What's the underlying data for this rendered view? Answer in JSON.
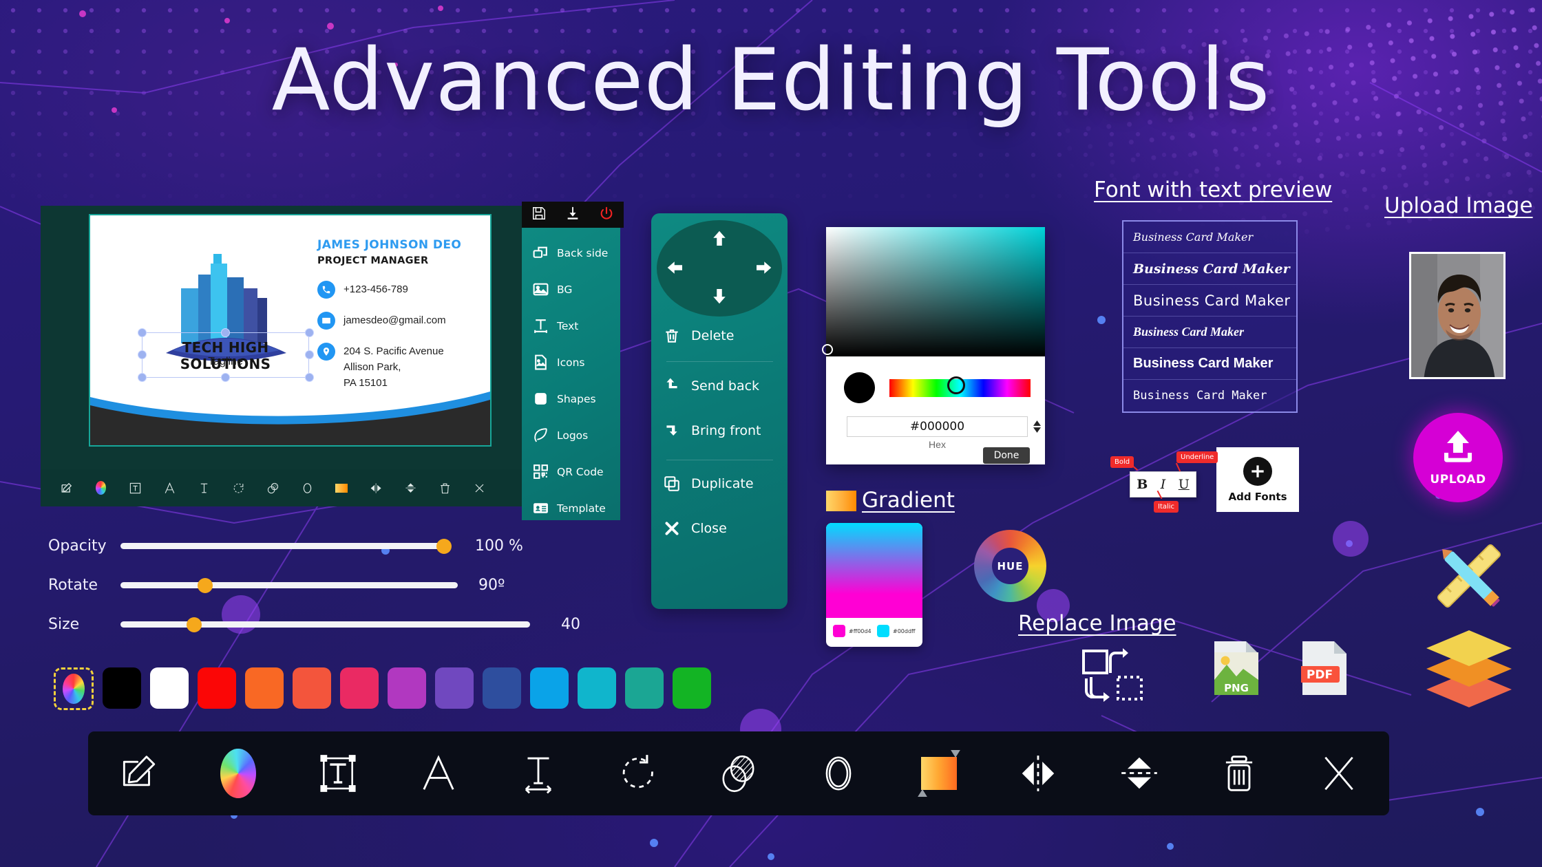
{
  "page": {
    "title": "Advanced Editing Tools"
  },
  "card": {
    "brand_name": "TECH HIGH SOLUTIONS",
    "tagline": "Tagline",
    "person_name": "JAMES JOHNSON DEO",
    "person_role": "PROJECT MANAGER",
    "phone": "+123-456-789",
    "email": "jamesdeo@gmail.com",
    "address_line1": "204 S. Pacific Avenue",
    "address_line2": "Allison Park,",
    "address_line3": "PA 15101"
  },
  "mini_toolbar": {
    "items": [
      {
        "icon": "edit-pencil-icon"
      },
      {
        "icon": "color-wheel-icon"
      },
      {
        "icon": "text-box-icon"
      },
      {
        "icon": "font-a-icon"
      },
      {
        "icon": "text-height-icon"
      },
      {
        "icon": "rotate-icon"
      },
      {
        "icon": "opacity-icon"
      },
      {
        "icon": "shape-circle-icon"
      },
      {
        "icon": "gradient-icon"
      },
      {
        "icon": "flip-horizontal-icon"
      },
      {
        "icon": "flip-vertical-icon"
      },
      {
        "icon": "trash-icon"
      },
      {
        "icon": "close-x-icon"
      }
    ]
  },
  "side_header": {
    "items": [
      {
        "label": "Save",
        "icon": "save-floppy-icon"
      },
      {
        "label": "Download",
        "icon": "download-icon"
      },
      {
        "label": "Power",
        "icon": "power-icon"
      }
    ]
  },
  "side_menu": {
    "items": [
      {
        "label": "Back side",
        "icon": "back-side-icon"
      },
      {
        "label": "BG",
        "icon": "image-bg-icon"
      },
      {
        "label": "Text",
        "icon": "text-tool-icon"
      },
      {
        "label": "Icons",
        "icon": "icons-file-icon"
      },
      {
        "label": "Shapes",
        "icon": "shapes-square-icon"
      },
      {
        "label": "Logos",
        "icon": "leaf-logo-icon"
      },
      {
        "label": "QR Code",
        "icon": "qr-code-icon"
      },
      {
        "label": "Template",
        "icon": "template-card-icon"
      }
    ]
  },
  "transform_panel": {
    "dpad": {
      "up": "move-up-arrow-icon",
      "down": "move-down-arrow-icon",
      "left": "move-left-arrow-icon",
      "right": "move-right-arrow-icon"
    },
    "items": [
      {
        "label": "Delete",
        "icon": "trash-icon"
      },
      {
        "label": "Send back",
        "icon": "send-back-icon"
      },
      {
        "label": "Bring front",
        "icon": "bring-front-icon"
      },
      {
        "label": "Duplicate",
        "icon": "duplicate-icon"
      },
      {
        "label": "Close",
        "icon": "close-x-icon"
      }
    ]
  },
  "color_picker": {
    "hex_value": "#000000",
    "hex_label": "Hex",
    "done_label": "Done",
    "swatch_color": "#000000"
  },
  "labels": {
    "font_preview": "Font with text preview",
    "upload_image": "Upload Image",
    "gradient": "Gradient",
    "replace_image": "Replace Image"
  },
  "gradient": {
    "color_1": "#ff00d4",
    "color_2": "#00ddff",
    "chip_1_label": "#ff00d4",
    "chip_2_label": "#00ddff"
  },
  "hue_wheel": {
    "label": "HUE"
  },
  "font_list": {
    "items": [
      {
        "label": "Business Card Maker"
      },
      {
        "label": "Business Card Maker"
      },
      {
        "label": "Business Card Maker"
      },
      {
        "label": "Business Card Maker"
      },
      {
        "label": "Business Card Maker"
      },
      {
        "label": "Business Card Maker"
      }
    ]
  },
  "text_style": {
    "bold_letter": "B",
    "italic_letter": "I",
    "underline_letter": "U",
    "bold_tag": "Bold",
    "italic_tag": "Italic",
    "underline_tag": "Underline"
  },
  "add_fonts": {
    "label": "Add Fonts",
    "icon": "plus-circle-icon"
  },
  "upload": {
    "label": "UPLOAD",
    "icon": "upload-arrow-icon"
  },
  "file_icons": {
    "png_label": "PNG",
    "pdf_label": "PDF"
  },
  "sliders": [
    {
      "label": "Opacity",
      "value_text": "100 %",
      "percent": 100
    },
    {
      "label": "Rotate",
      "value_text": "90º",
      "percent": 25
    },
    {
      "label": "Size",
      "value_text": "40",
      "percent": 18
    }
  ],
  "swatches": [
    {
      "name": "custom-color-picker",
      "color": "rainbow"
    },
    {
      "name": "black",
      "color": "#000000"
    },
    {
      "name": "white",
      "color": "#ffffff"
    },
    {
      "name": "red",
      "color": "#fb0606"
    },
    {
      "name": "orange",
      "color": "#f96824"
    },
    {
      "name": "tomato",
      "color": "#f3553c"
    },
    {
      "name": "pink",
      "color": "#ea2a63"
    },
    {
      "name": "magenta",
      "color": "#b138c0"
    },
    {
      "name": "purple",
      "color": "#7048bf"
    },
    {
      "name": "indigo",
      "color": "#2e4e9e"
    },
    {
      "name": "blue",
      "color": "#0aa3e8"
    },
    {
      "name": "cyan",
      "color": "#10b5cc"
    },
    {
      "name": "teal",
      "color": "#1ba694"
    },
    {
      "name": "green",
      "color": "#13b424"
    }
  ],
  "bottom_toolbar": {
    "items": [
      {
        "name": "edit-pencil-icon"
      },
      {
        "name": "color-wheel-icon"
      },
      {
        "name": "text-box-icon"
      },
      {
        "name": "font-a-icon"
      },
      {
        "name": "text-height-icon"
      },
      {
        "name": "rotate-icon"
      },
      {
        "name": "opacity-icon"
      },
      {
        "name": "shape-circle-icon"
      },
      {
        "name": "gradient-icon"
      },
      {
        "name": "flip-horizontal-icon"
      },
      {
        "name": "flip-vertical-icon"
      },
      {
        "name": "trash-icon"
      },
      {
        "name": "close-x-icon"
      }
    ]
  },
  "colors": {
    "teal_panel": "#0d8a82",
    "editor_bg": "#0d3733",
    "accent_orange": "#f5a81c",
    "magenta": "#d500d5",
    "card_name_blue": "#2e9bf0"
  }
}
